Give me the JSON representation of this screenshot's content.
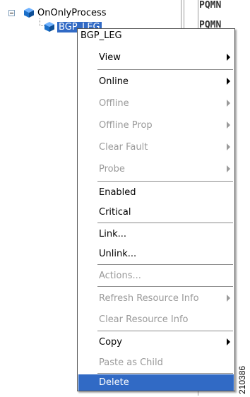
{
  "tree": {
    "root_label": "OnOnlyProcess",
    "child_label": "BGP_LEG"
  },
  "background": {
    "column_header_1": "PQMN",
    "column_header_2": "PQMN"
  },
  "menu": {
    "title": "BGP_LEG",
    "items": [
      {
        "label": "View",
        "enabled": true,
        "submenu": true
      },
      {
        "label": "Online",
        "enabled": true,
        "submenu": true
      },
      {
        "label": "Offline",
        "enabled": false,
        "submenu": true
      },
      {
        "label": "Offline Prop",
        "enabled": false,
        "submenu": true
      },
      {
        "label": "Clear Fault",
        "enabled": false,
        "submenu": true
      },
      {
        "label": "Probe",
        "enabled": false,
        "submenu": true
      },
      {
        "label": "Enabled",
        "enabled": true,
        "submenu": false
      },
      {
        "label": "Critical",
        "enabled": true,
        "submenu": false
      },
      {
        "label": "Link...",
        "enabled": true,
        "submenu": false
      },
      {
        "label": "Unlink...",
        "enabled": true,
        "submenu": false
      },
      {
        "label": "Actions...",
        "enabled": false,
        "submenu": false
      },
      {
        "label": "Refresh Resource Info",
        "enabled": false,
        "submenu": true
      },
      {
        "label": "Clear Resource Info",
        "enabled": false,
        "submenu": false
      },
      {
        "label": "Copy",
        "enabled": true,
        "submenu": true
      },
      {
        "label": "Paste as Child",
        "enabled": false,
        "submenu": false
      },
      {
        "label": "Delete",
        "enabled": true,
        "submenu": false,
        "selected": true
      }
    ]
  },
  "figure_number": "210386",
  "colors": {
    "selection": "#316ac5",
    "disabled_text": "#9a9a9a",
    "cube_blue": "#1a6fc9"
  }
}
